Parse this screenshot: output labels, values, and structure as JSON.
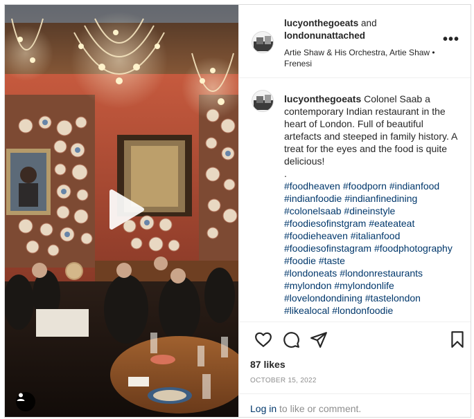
{
  "post": {
    "author": "lucyonthegoeats",
    "joiner": "and",
    "coauthor": "londonunattached",
    "audio": "Artie Shaw & His Orchestra, Artie Shaw • Frenesi",
    "more_label": "•••"
  },
  "caption": {
    "username": "lucyonthegoeats",
    "text": "Colonel Saab a contemporary Indian restaurant in the heart of London. Full of beautiful artefacts and steeped in family history. A treat for the eyes and the food is quite delicious!",
    "dot": ".",
    "hashtags_1": [
      "#foodheaven",
      "#foodporn",
      "#indianfood",
      "#indianfoodie",
      "#indianfinedining",
      "#colonelsaab",
      "#dineinstyle",
      "#foodiesofinstgram",
      "#eateateat",
      "#foodieheaven",
      "#italianfood",
      "#foodiesofinstagram",
      "#foodphotography",
      "#foodie",
      "#taste"
    ],
    "hashtags_2": [
      "#londoneats",
      "#londonrestaurants",
      "#mylondon",
      "#mylondonlife",
      "#lovelondondining",
      "#tastelondon",
      "#likealocal",
      "#londonfoodie"
    ]
  },
  "stats": {
    "likes": "87 likes",
    "date": "OCTOBER 15, 2022"
  },
  "footer": {
    "login": "Log in",
    "rest": " to like or comment."
  },
  "icons": {
    "like": "heart-icon",
    "comment": "comment-bubble-icon",
    "share": "paper-plane-icon",
    "save": "bookmark-icon",
    "play": "play-icon",
    "tag": "user-tag-icon"
  },
  "colors": {
    "link": "#00376b",
    "muted": "#8e8e8e",
    "text": "#262626",
    "wall": "#c4573f"
  }
}
